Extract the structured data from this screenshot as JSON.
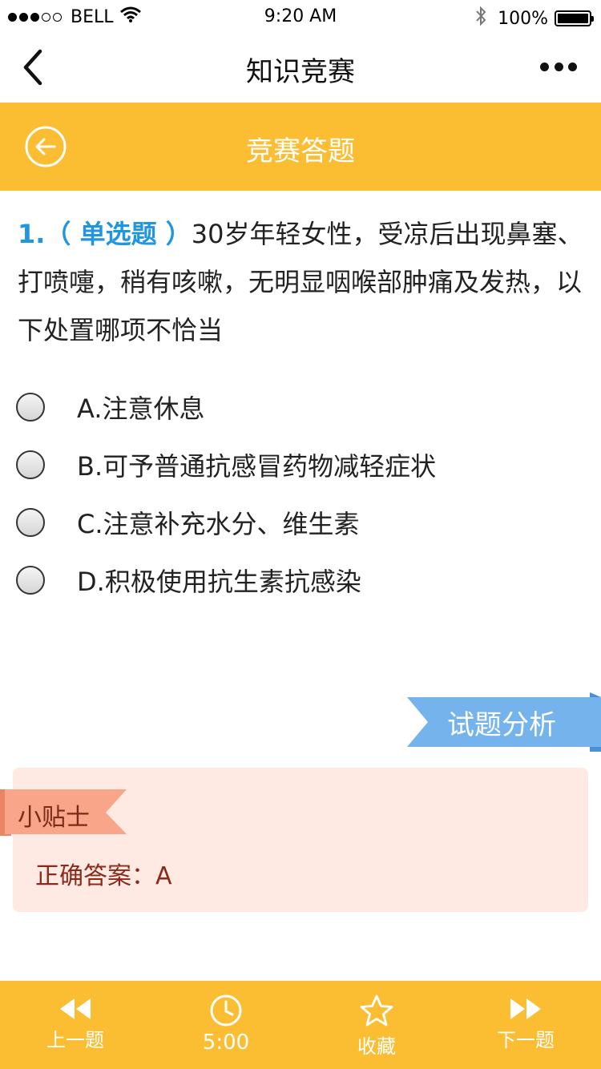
{
  "status_bar": {
    "carrier": "BELL",
    "time": "9:20 AM",
    "battery": "100%",
    "battery_level": 1.0,
    "signal_filled": 3,
    "signal_total": 5
  },
  "nav": {
    "title": "知识竞赛"
  },
  "header": {
    "title": "竞赛答题"
  },
  "question": {
    "number": "1.",
    "type": "（ 单选题 ）",
    "text": "30岁年轻女性，受凉后出现鼻塞、打喷嚏，稍有咳嗽，无明显咽喉部肿痛及发热，以下处置哪项不恰当"
  },
  "options": [
    {
      "label": "A.注意休息"
    },
    {
      "label": "B.可予普通抗感冒药物减轻症状"
    },
    {
      "label": "C.注意补充水分、维生素"
    },
    {
      "label": "D.积极使用抗生素抗感染"
    }
  ],
  "analysis": {
    "label": "试题分析"
  },
  "tips": {
    "title": "小贴士",
    "answer": "正确答案：A"
  },
  "bottom_bar": {
    "prev": "上一题",
    "timer": "5:00",
    "favorite": "收藏",
    "next": "下一题"
  },
  "colors": {
    "accent_yellow": "#fbbd31",
    "question_blue": "#2196e0",
    "analysis_blue": "#74b3ec",
    "tips_bg": "#fee9e3",
    "tips_tag": "#f9a58a"
  }
}
